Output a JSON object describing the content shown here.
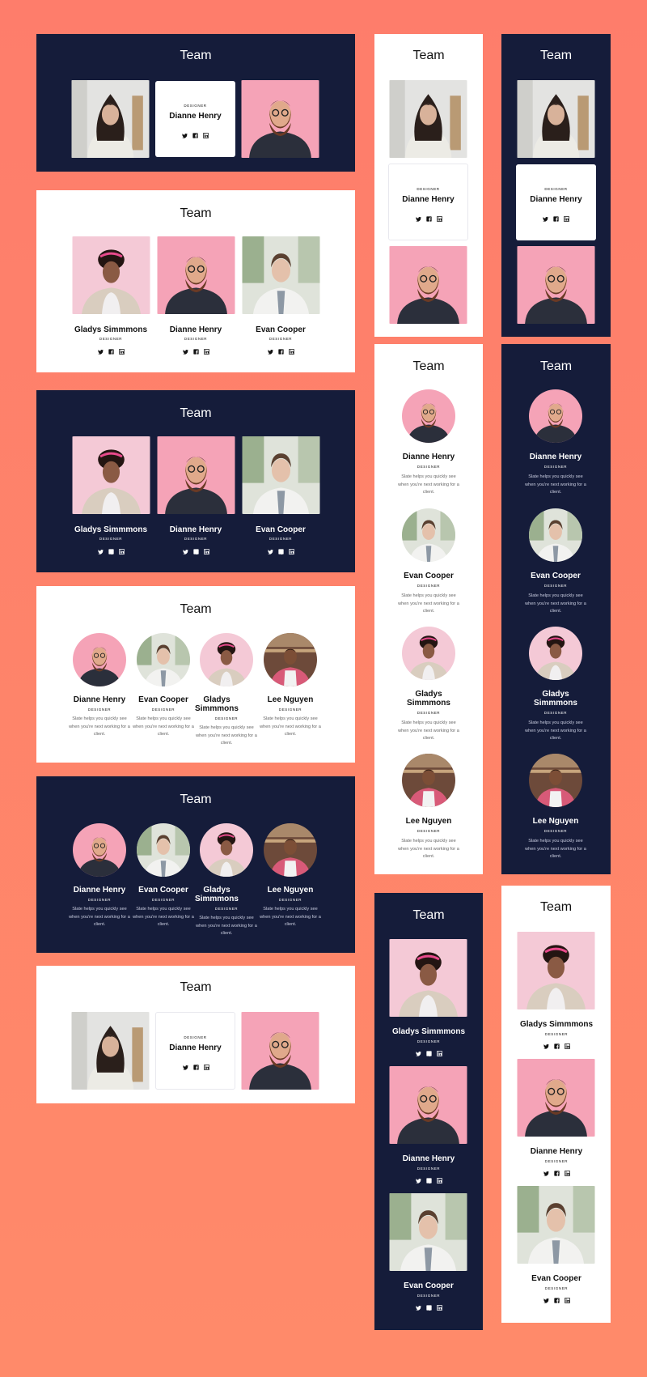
{
  "section_title": "Team",
  "role_label": "DESIGNER",
  "bio_text": "Slate helps you quickly see when you're next working for a client.",
  "people": {
    "gladys": "Gladys Simmmons",
    "dianne": "Dianne Henry",
    "evan": "Evan Cooper",
    "lee": "Lee Nguyen"
  },
  "social_icons": [
    "twitter-icon",
    "facebook-icon",
    "linkedin-icon"
  ],
  "colors": {
    "background": "#fe7d6b",
    "navy": "#151c3a",
    "white": "#ffffff",
    "pink_photo": "#f5a3b7",
    "pale_pink_photo": "#f4c9d6",
    "gray_photo": "#dcdcdc",
    "bakery_photo": "#6d4a3a"
  }
}
